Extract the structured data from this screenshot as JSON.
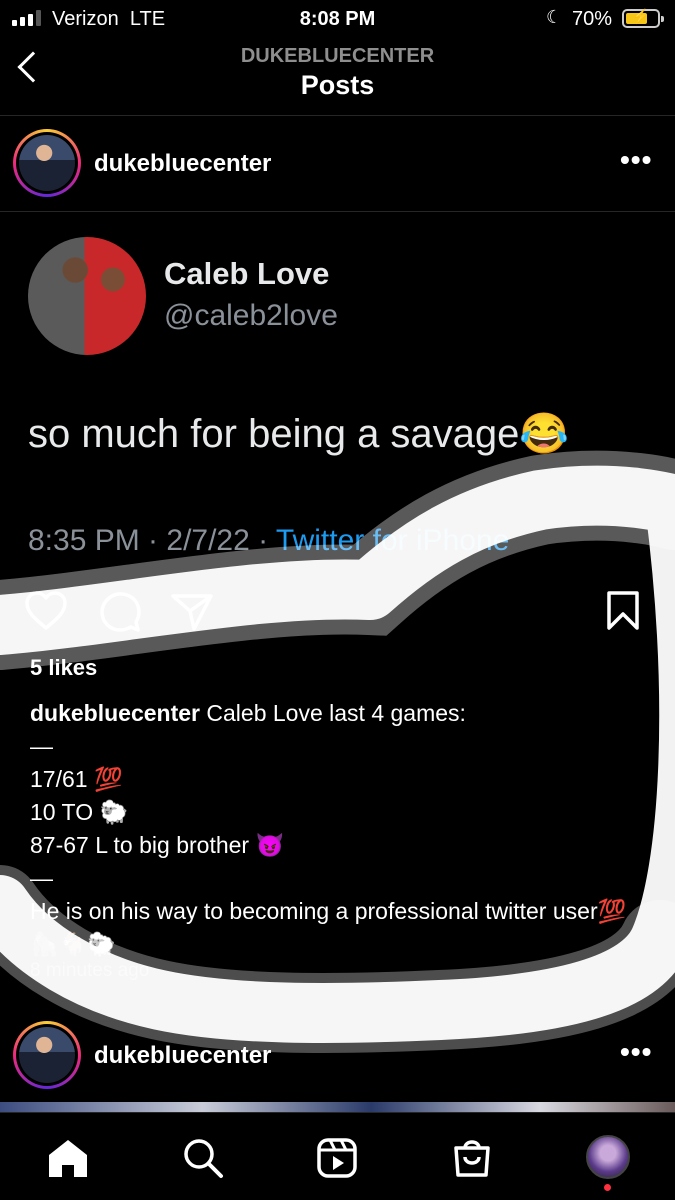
{
  "status_bar": {
    "carrier": "Verizon",
    "network": "LTE",
    "time": "8:08 PM",
    "battery": "70%",
    "battery_level": 0.7,
    "icons": [
      "signal-icon",
      "moon-icon",
      "battery-charging-icon"
    ]
  },
  "header": {
    "subtitle": "DUKEBLUECENTER",
    "title": "Posts",
    "icons": [
      "back-chevron-icon"
    ]
  },
  "post": {
    "username": "dukebluecenter",
    "tweet": {
      "name": "Caleb Love",
      "handle": "@caleb2love",
      "text": "so much for being a savage😂",
      "time": "8:35 PM · 2/7/22 · ",
      "source": "Twitter for iPhone"
    },
    "likes": "5 likes",
    "caption": {
      "username": "dukebluecenter",
      "first_line": " Caleb Love last 4 games:",
      "lines": [
        "—",
        "17/61 💯",
        "10 TO 🐑",
        "87-67 L to big brother 😈",
        "—",
        "He is on his way to becoming a professional twitter user💯🦍🐐🐑"
      ]
    },
    "time_ago": "8 minutes ago",
    "icons": [
      "heart-icon",
      "comment-icon",
      "share-icon",
      "bookmark-icon",
      "more-icon"
    ]
  },
  "next_post": {
    "username": "dukebluecenter"
  },
  "tab_bar": {
    "items": [
      "home-icon",
      "search-icon",
      "reels-icon",
      "shop-icon",
      "profile-avatar"
    ]
  },
  "overlay_color": "#ffffff"
}
